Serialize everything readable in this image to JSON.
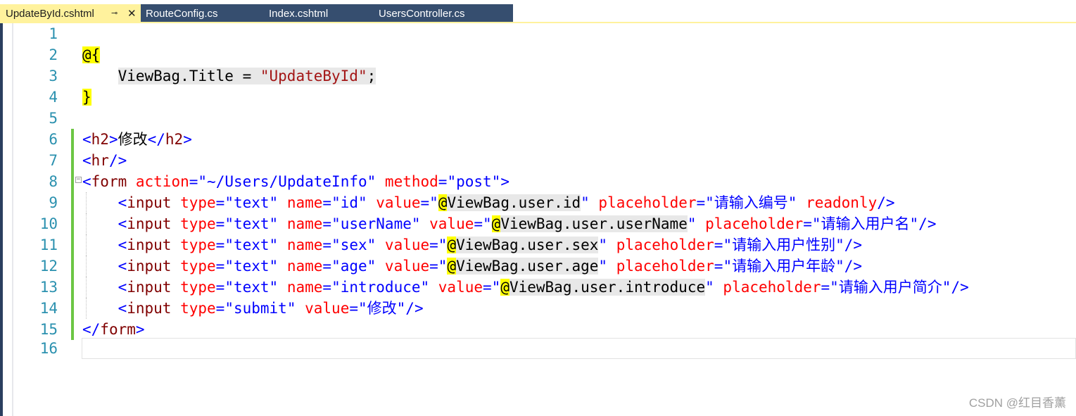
{
  "tabs": [
    {
      "label": "UpdateById.cshtml",
      "active": true,
      "pin_icon": "pin-icon",
      "close_icon": "close-icon"
    },
    {
      "label": "RouteConfig.cs",
      "active": false
    },
    {
      "label": "Index.cshtml",
      "active": false
    },
    {
      "label": "UsersController.cs",
      "active": false
    }
  ],
  "line_numbers": [
    "1",
    "2",
    "3",
    "4",
    "5",
    "6",
    "7",
    "8",
    "9",
    "10",
    "11",
    "12",
    "13",
    "14",
    "15",
    "16"
  ],
  "code": {
    "l2": {
      "at": "@",
      "brace": "{"
    },
    "l3": {
      "indent": "    ",
      "left": "ViewBag.Title = ",
      "str": "\"UpdateById\"",
      "semi": ";"
    },
    "l4": {
      "brace": "}"
    },
    "l6": {
      "open": "<",
      "tag": "h2",
      "close": ">",
      "text": "修改",
      "endopen": "</",
      "endtag": "h2",
      "endclose": ">"
    },
    "l7": {
      "open": "<",
      "tag": "hr",
      "close": "/>"
    },
    "l8": {
      "open": "<",
      "tag": "form",
      "a1": " action",
      "eq1": "=",
      "v1": "\"~/Users/UpdateInfo\"",
      "a2": " method",
      "eq2": "=",
      "v2": "\"post\"",
      "close": ">"
    },
    "l9": {
      "indent": "    ",
      "open": "<",
      "tag": "input",
      "a1": " type",
      "eq1": "=",
      "v1": "\"text\"",
      "a2": " name",
      "eq2": "=",
      "v2": "\"id\"",
      "a3": " value",
      "eq3": "=",
      "q1": "\"",
      "at": "@",
      "razor": "ViewBag.user.id",
      "q2": "\"",
      "a4": " placeholder",
      "eq4": "=",
      "v4": "\"请输入编号\"",
      "a5": " readonly",
      "close": "/>"
    },
    "l10": {
      "indent": "    ",
      "open": "<",
      "tag": "input",
      "a1": " type",
      "eq1": "=",
      "v1": "\"text\"",
      "a2": " name",
      "eq2": "=",
      "v2": "\"userName\"",
      "a3": " value",
      "eq3": "=",
      "q1": "\"",
      "at": "@",
      "razor": "ViewBag.user.userName",
      "q2": "\"",
      "a4": " placeholder",
      "eq4": "=",
      "v4": "\"请输入用户名\"",
      "close": "/>"
    },
    "l11": {
      "indent": "    ",
      "open": "<",
      "tag": "input",
      "a1": " type",
      "eq1": "=",
      "v1": "\"text\"",
      "a2": " name",
      "eq2": "=",
      "v2": "\"sex\"",
      "a3": " value",
      "eq3": "=",
      "q1": "\"",
      "at": "@",
      "razor": "ViewBag.user.sex",
      "q2": "\"",
      "a4": " placeholder",
      "eq4": "=",
      "v4": "\"请输入用户性别\"",
      "close": "/>"
    },
    "l12": {
      "indent": "    ",
      "open": "<",
      "tag": "input",
      "a1": " type",
      "eq1": "=",
      "v1": "\"text\"",
      "a2": " name",
      "eq2": "=",
      "v2": "\"age\"",
      "a3": " value",
      "eq3": "=",
      "q1": "\"",
      "at": "@",
      "razor": "ViewBag.user.age",
      "q2": "\"",
      "a4": " placeholder",
      "eq4": "=",
      "v4": "\"请输入用户年龄\"",
      "close": "/>"
    },
    "l13": {
      "indent": "    ",
      "open": "<",
      "tag": "input",
      "a1": " type",
      "eq1": "=",
      "v1": "\"text\"",
      "a2": " name",
      "eq2": "=",
      "v2": "\"introduce\"",
      "a3": " value",
      "eq3": "=",
      "q1": "\"",
      "at": "@",
      "razor": "ViewBag.user.introduce",
      "q2": "\"",
      "a4": " placeholder",
      "eq4": "=",
      "v4": "\"请输入用户简介\"",
      "close": "/>"
    },
    "l14": {
      "indent": "    ",
      "open": "<",
      "tag": "input",
      "a1": " type",
      "eq1": "=",
      "v1": "\"submit\"",
      "a2": " value",
      "eq2": "=",
      "v2": "\"修改\"",
      "close": "/>"
    },
    "l15": {
      "open": "</",
      "tag": "form",
      "close": ">"
    }
  },
  "collapse_glyph": "⊟",
  "watermark": "CSDN @红目香薰",
  "colors": {
    "tab_active": "#fff29d",
    "tab_bg": "#364e6f",
    "line_number": "#2b91af",
    "change_marker": "#6cc644",
    "razor_at": "#ffff00"
  }
}
